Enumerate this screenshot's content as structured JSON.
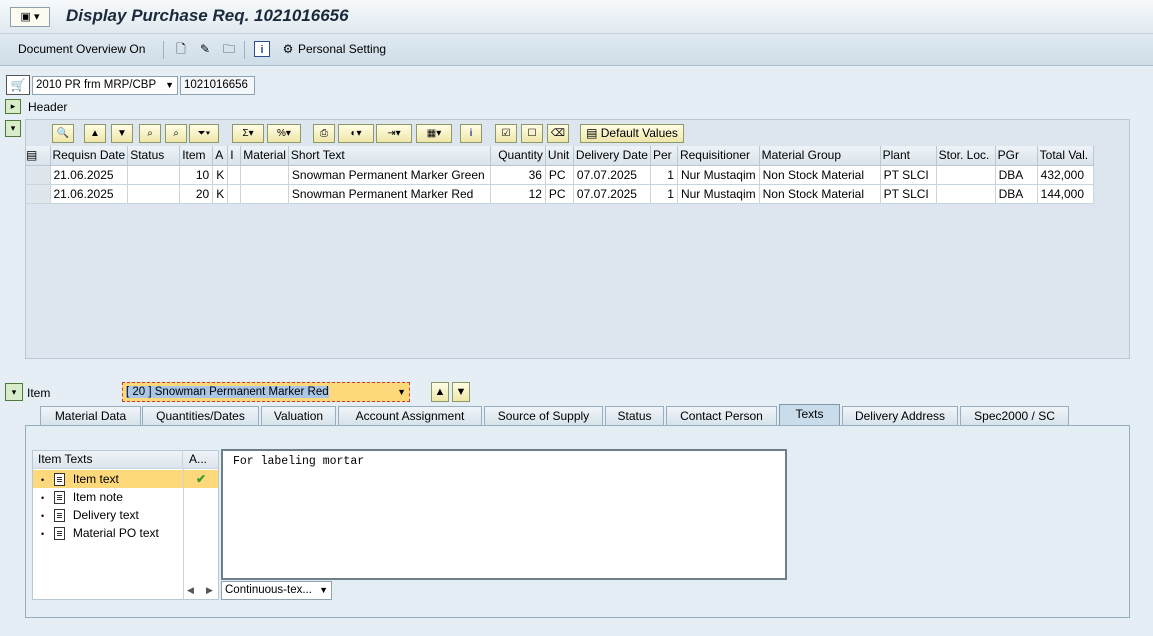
{
  "window": {
    "title": "Display Purchase Req. 1021016656"
  },
  "toolbar": {
    "doc_overview_label": "Document Overview On",
    "personal_setting_label": "Personal Setting"
  },
  "header_bar": {
    "doc_type_value": "2010 PR frm MRP/CBP",
    "pr_number_value": "1021016656",
    "header_label": "Header"
  },
  "grid_toolbar": {
    "default_values_label": "Default Values"
  },
  "items_table": {
    "columns": [
      "Requisn Date",
      "Status",
      "Item",
      "A",
      "I",
      "Material",
      "Short Text",
      "Quantity",
      "Unit",
      "Delivery Date",
      "Per",
      "Requisitioner",
      "Material Group",
      "Plant",
      "Stor. Loc.",
      "PGr",
      "Total Val."
    ],
    "rows": [
      {
        "requisn_date": "21.06.2025",
        "status": "",
        "item": "10",
        "a": "K",
        "i": "",
        "material": "",
        "short_text": "Snowman Permanent Marker Green",
        "quantity": "36",
        "unit": "PC",
        "delivery_date": "07.07.2025",
        "per": "1",
        "requisitioner": "Nur Mustaqim",
        "material_group": "Non Stock Material",
        "plant": "PT SLCI",
        "stor_loc": "",
        "pgr": "DBA",
        "total_val": "432,000"
      },
      {
        "requisn_date": "21.06.2025",
        "status": "",
        "item": "20",
        "a": "K",
        "i": "",
        "material": "",
        "short_text": "Snowman Permanent Marker Red",
        "quantity": "12",
        "unit": "PC",
        "delivery_date": "07.07.2025",
        "per": "1",
        "requisitioner": "Nur Mustaqim",
        "material_group": "Non Stock Material",
        "plant": "PT SLCI",
        "stor_loc": "",
        "pgr": "DBA",
        "total_val": "144,000"
      }
    ]
  },
  "item_section": {
    "label": "Item",
    "selected_item": "[ 20 ] Snowman Permanent Marker Red"
  },
  "tabs": [
    "Material Data",
    "Quantities/Dates",
    "Valuation",
    "Account Assignment",
    "Source of Supply",
    "Status",
    "Contact Person",
    "Texts",
    "Delivery Address",
    "Spec2000 / SC"
  ],
  "active_tab": "Texts",
  "texts_panel": {
    "tree_header": "Item Texts",
    "col_a_header": "A...",
    "items": [
      "Item text",
      "Item note",
      "Delivery text",
      "Material PO text"
    ],
    "editor_text": "For labeling mortar",
    "format_select": "Continuous-tex..."
  },
  "colors": {
    "accent": "#fdd97c",
    "checkmark": "#3a9a2a"
  }
}
